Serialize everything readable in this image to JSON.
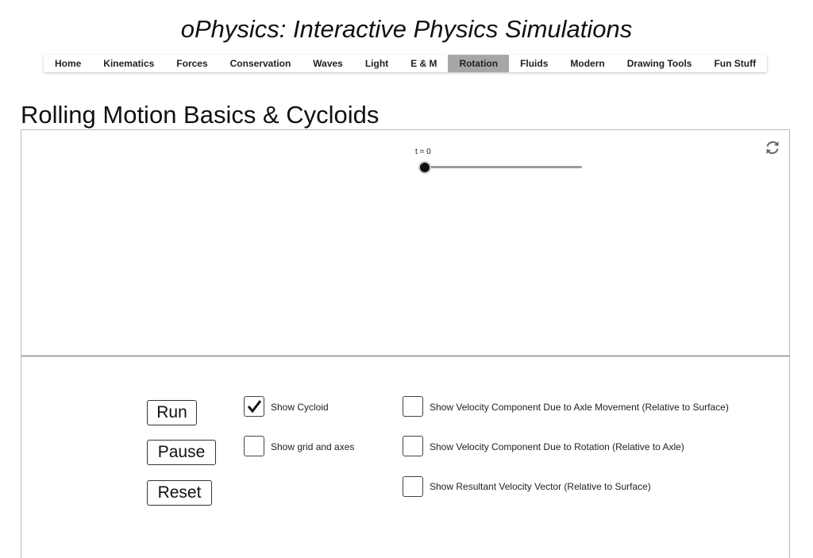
{
  "site": {
    "title": "oPhysics: Interactive Physics Simulations"
  },
  "nav": {
    "items": [
      {
        "label": "Home"
      },
      {
        "label": "Kinematics"
      },
      {
        "label": "Forces"
      },
      {
        "label": "Conservation"
      },
      {
        "label": "Waves"
      },
      {
        "label": "Light"
      },
      {
        "label": "E & M"
      },
      {
        "label": "Rotation"
      },
      {
        "label": "Fluids"
      },
      {
        "label": "Modern"
      },
      {
        "label": "Drawing Tools"
      },
      {
        "label": "Fun Stuff"
      }
    ],
    "active": "Rotation"
  },
  "page": {
    "heading": "Rolling Motion Basics & Cycloids"
  },
  "sim": {
    "slider": {
      "label": "t = 0",
      "value": 0
    },
    "buttons": {
      "run": "Run",
      "pause": "Pause",
      "reset": "Reset"
    },
    "checkboxes": {
      "show_cycloid": {
        "label": "Show Cycloid",
        "checked": true
      },
      "show_grid": {
        "label": "Show grid and axes",
        "checked": false
      },
      "velocity_axle": {
        "label": "Show Velocity Component Due to Axle Movement (Relative to Surface)",
        "checked": false
      },
      "velocity_rotation": {
        "label": "Show Velocity Component Due to Rotation (Relative to Axle)",
        "checked": false
      },
      "velocity_resultant": {
        "label": "Show Resultant Velocity Vector (Relative to Surface)",
        "checked": false
      }
    },
    "icons": {
      "reset_view": "refresh-icon",
      "checkmark": "checkmark-icon"
    }
  }
}
